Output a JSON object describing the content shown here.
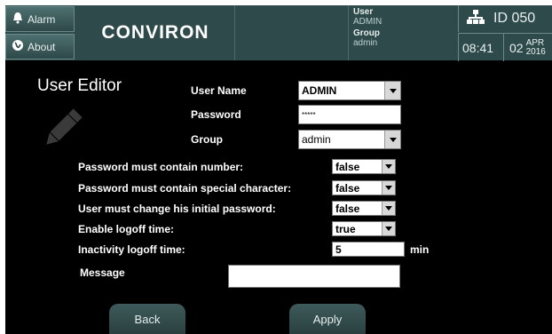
{
  "header": {
    "alarm_label": "Alarm",
    "about_label": "About",
    "logo_text": "CONVIRON",
    "user_label": "User",
    "user_value": "ADMIN",
    "group_label": "Group",
    "group_value": "admin",
    "id_text": "ID 050",
    "time": "08:41",
    "day": "02",
    "month": "APR",
    "year": "2016"
  },
  "editor": {
    "title": "User Editor",
    "username_label": "User Name",
    "username_value": "ADMIN",
    "password_label": "Password",
    "password_value": "*****",
    "group_label": "Group",
    "group_value": "admin",
    "options": [
      {
        "label": "Password must contain number:",
        "value": "false"
      },
      {
        "label": "Password must contain special character:",
        "value": "false"
      },
      {
        "label": "User must change his initial password:",
        "value": "false"
      },
      {
        "label": "Enable logoff time:",
        "value": "true"
      }
    ],
    "inactivity_label": "Inactivity logoff time:",
    "inactivity_value": "5",
    "inactivity_unit": "min",
    "message_label": "Message",
    "message_value": ""
  },
  "footer": {
    "back_label": "Back",
    "apply_label": "Apply"
  },
  "colors": {
    "header_bg": "#2f4a4a",
    "button_bg": "#3e5a5a",
    "screen_bg": "#000000"
  }
}
